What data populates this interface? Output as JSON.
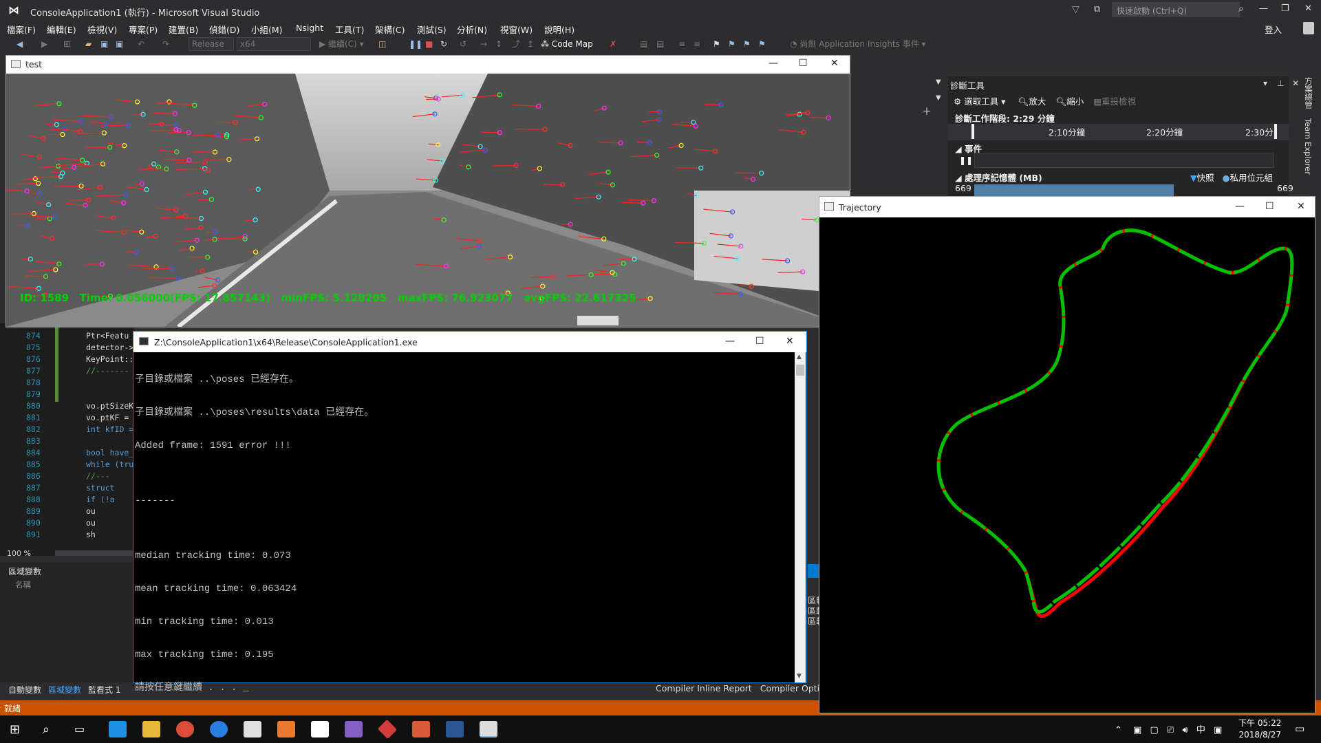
{
  "vs": {
    "title": "ConsoleApplication1 (執行) - Microsoft Visual Studio",
    "quick_launch": "快速啟動 (Ctrl+Q)",
    "login": "登入",
    "menus": [
      "檔案(F)",
      "編輯(E)",
      "檢視(V)",
      "專案(P)",
      "建置(B)",
      "偵錯(D)",
      "小組(M)",
      "Nsight",
      "工具(T)",
      "架構(C)",
      "測試(S)",
      "分析(N)",
      "視窗(W)",
      "說明(H)"
    ],
    "toolbar": {
      "config": "Release",
      "platform": "x64",
      "continue": "繼續(C)",
      "code_map": "Code Map",
      "app_insights": "尚無 Application Insights 事件"
    }
  },
  "editor": {
    "lines": [
      {
        "n": "874",
        "t": "Ptr<Featu"
      },
      {
        "n": "875",
        "t": "detector->"
      },
      {
        "n": "876",
        "t": "KeyPoint::"
      },
      {
        "n": "877",
        "t": "//-------"
      },
      {
        "n": "878",
        "t": ""
      },
      {
        "n": "879",
        "t": ""
      },
      {
        "n": "880",
        "t": "vo.ptSizeK"
      },
      {
        "n": "881",
        "t": "vo.ptKF ="
      },
      {
        "n": "882",
        "t": "int kfID ="
      },
      {
        "n": "883",
        "t": ""
      },
      {
        "n": "884",
        "t": "bool have_"
      },
      {
        "n": "885",
        "t": "while (tru"
      },
      {
        "n": "886",
        "t": "  //---"
      },
      {
        "n": "887",
        "t": "  struct"
      },
      {
        "n": "888",
        "t": "  if (!a"
      },
      {
        "n": "889",
        "t": "    ou"
      },
      {
        "n": "890",
        "t": "    ou"
      },
      {
        "n": "891",
        "t": "    sh"
      }
    ],
    "zoom": "100 %",
    "locals_title": "區域變數",
    "locals_col": "名稱",
    "tabs": [
      "自動變數",
      "區域變數",
      "監看式 1"
    ]
  },
  "status": "就緒",
  "diag": {
    "title": "診斷工具",
    "select_tools": "選取工具",
    "zoom_in": "放大",
    "zoom_out": "縮小",
    "reset_view": "重設檢視",
    "session": "診斷工作階段: 2:29 分鐘",
    "ticks": [
      "2:10分鐘",
      "2:20分鐘",
      "2:30分"
    ],
    "events": "事件",
    "memory": "處理序記憶體 (MB)",
    "snapshot": "快照",
    "private_bytes": "私用位元組",
    "mem_left": "669",
    "mem_right": "669",
    "side_tabs": [
      "方案總管",
      "Team Explorer"
    ]
  },
  "test_window": {
    "title": "test",
    "overlay": "ID: 1589   Time: 0.056000(FPS: 17.857143)   minFPS: 5.128205   maxFPS: 76.923077   avgFPS: 22.617325"
  },
  "console": {
    "title": "Z:\\ConsoleApplication1\\x64\\Release\\ConsoleApplication1.exe",
    "lines": [
      "子目錄或檔案 ..\\poses 已經存在。",
      "子目錄或檔案 ..\\poses\\results\\data 已經存在。",
      "Added frame: 1591 error !!!",
      "",
      "-------",
      "",
      "median tracking time: 0.073",
      "mean tracking time: 0.063424",
      "min tracking time: 0.013",
      "max tracking time: 0.195",
      "請按任意鍵繼續 . . . _"
    ]
  },
  "trajectory": {
    "title": "Trajectory",
    "gt_color": "#ff0000",
    "est_color": "#00c000"
  },
  "compiler_tabs": [
    "Compiler Inline Report",
    "Compiler Optimiz"
  ],
  "right_side_labels": [
    "區載",
    "區載",
    "區載"
  ],
  "taskbar": {
    "time": "下午 05:22",
    "date": "2018/8/27",
    "ime": "中"
  }
}
